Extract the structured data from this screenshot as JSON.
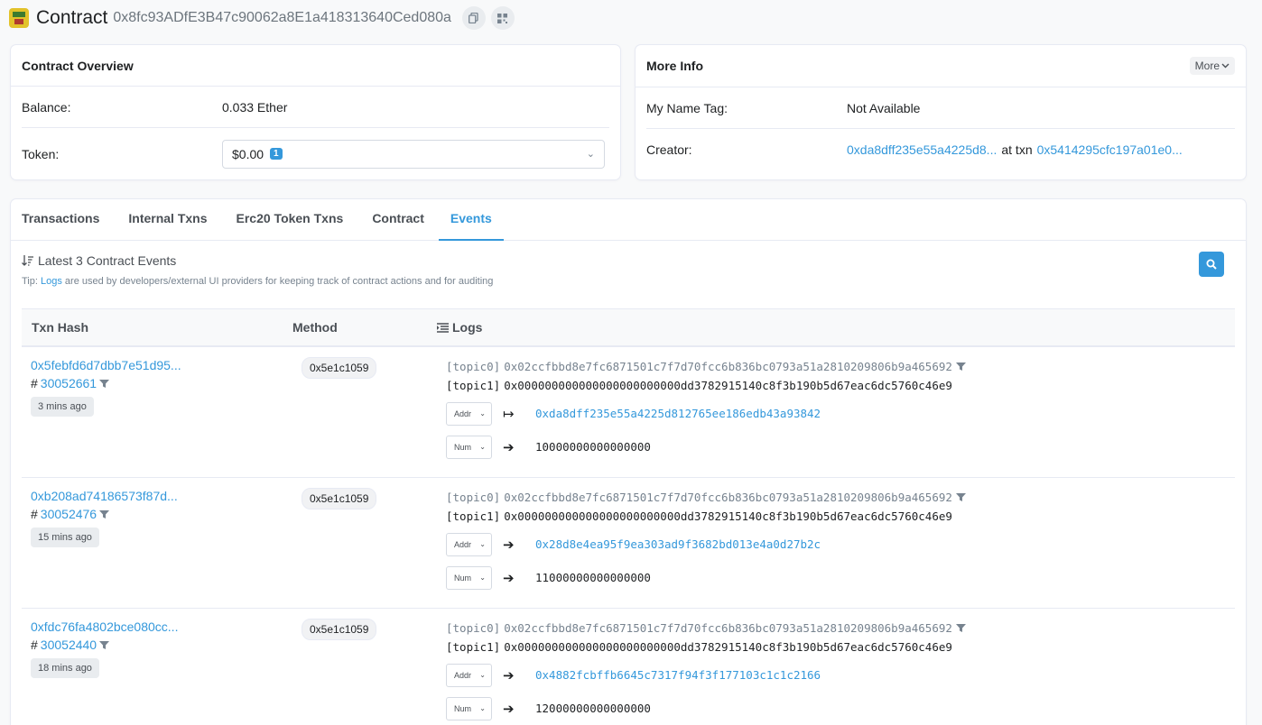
{
  "header": {
    "title": "Contract",
    "address": "0x8fc93ADfE3B47c90062a8E1a418313640Ced080a"
  },
  "overview": {
    "title": "Contract Overview",
    "balance_label": "Balance:",
    "balance_value": "0.033 Ether",
    "token_label": "Token:",
    "token_value": "$0.00",
    "token_count": "1"
  },
  "more_info": {
    "title": "More Info",
    "more_button": "More",
    "name_tag_label": "My Name Tag:",
    "name_tag_value": "Not Available",
    "creator_label": "Creator:",
    "creator_address": "0xda8dff235e55a4225d8...",
    "at_txn": "at txn",
    "creator_txn": "0x5414295cfc197a01e0..."
  },
  "tabs": [
    {
      "label": "Transactions"
    },
    {
      "label": "Internal Txns"
    },
    {
      "label": "Erc20 Token Txns"
    },
    {
      "label": "Contract"
    },
    {
      "label": "Events"
    }
  ],
  "events": {
    "heading": "Latest 3 Contract Events",
    "tip_prefix": "Tip:",
    "tip_link": "Logs",
    "tip_rest": "are used by developers/external UI providers for keeping track of contract actions and for auditing",
    "columns": {
      "hash": "Txn Hash",
      "method": "Method",
      "logs": "Logs"
    },
    "rows": [
      {
        "hash": "0x5febfd6d7dbb7e51d95...",
        "block_prefix": "#",
        "block": "30052661",
        "age": "3 mins ago",
        "method": "0x5e1c1059",
        "topic0_label": "[topic0]",
        "topic0": "0x02ccfbbd8e7fc6871501c7f7d70fcc6b836bc0793a51a2810209806b9a465692",
        "topic1_label": "[topic1]",
        "topic1": "0x000000000000000000000000dd3782915140c8f3b190b5d67eac6dc5760c46e9",
        "data1_type": "Addr",
        "data1_value": "0xda8dff235e55a4225d812765ee186edb43a93842",
        "data2_type": "Num",
        "data2_value": "10000000000000000"
      },
      {
        "hash": "0xb208ad74186573f87d...",
        "block_prefix": "#",
        "block": "30052476",
        "age": "15 mins ago",
        "method": "0x5e1c1059",
        "topic0_label": "[topic0]",
        "topic0": "0x02ccfbbd8e7fc6871501c7f7d70fcc6b836bc0793a51a2810209806b9a465692",
        "topic1_label": "[topic1]",
        "topic1": "0x000000000000000000000000dd3782915140c8f3b190b5d67eac6dc5760c46e9",
        "data1_type": "Addr",
        "data1_value": "0x28d8e4ea95f9ea303ad9f3682bd013e4a0d27b2c",
        "data2_type": "Num",
        "data2_value": "11000000000000000"
      },
      {
        "hash": "0xfdc76fa4802bce080cc...",
        "block_prefix": "#",
        "block": "30052440",
        "age": "18 mins ago",
        "method": "0x5e1c1059",
        "topic0_label": "[topic0]",
        "topic0": "0x02ccfbbd8e7fc6871501c7f7d70fcc6b836bc0793a51a2810209806b9a465692",
        "topic1_label": "[topic1]",
        "topic1": "0x000000000000000000000000dd3782915140c8f3b190b5d67eac6dc5760c46e9",
        "data1_type": "Addr",
        "data1_value": "0x4882fcbffb6645c7317f94f3f177103c1c1c2166",
        "data2_type": "Num",
        "data2_value": "12000000000000000"
      }
    ]
  },
  "colors": {
    "accent": "#3498db",
    "text": "#1e2022",
    "muted": "#77838f",
    "border": "#e7eaf3",
    "page_bg": "#f8f9fa"
  }
}
